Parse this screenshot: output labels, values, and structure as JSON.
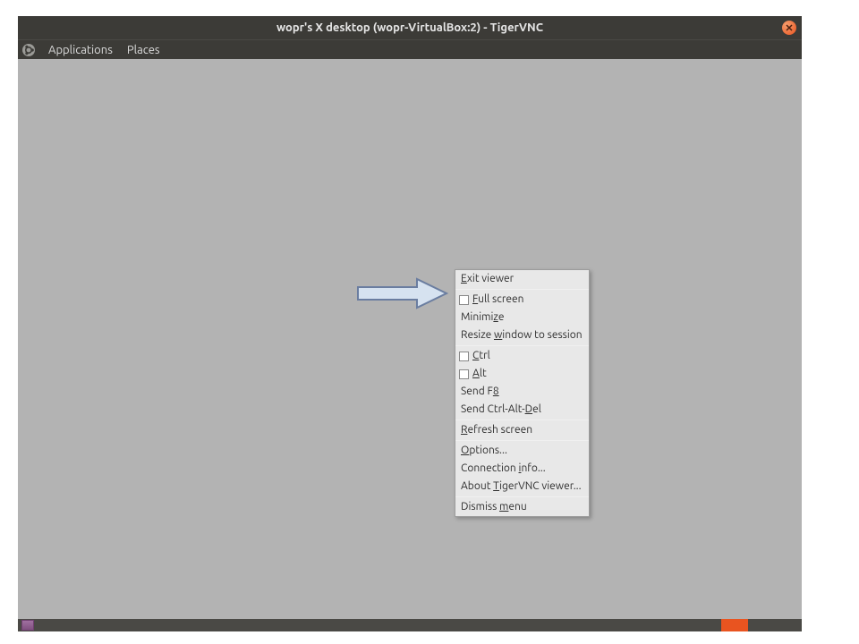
{
  "titlebar": {
    "title": "wopr's X desktop (wopr-VirtualBox:2) - TigerVNC"
  },
  "menubar": {
    "applications": "Applications",
    "places": "Places"
  },
  "context_menu": {
    "exit_viewer": {
      "pre": "",
      "u": "E",
      "post": "xit viewer"
    },
    "full_screen": {
      "pre": "",
      "u": "F",
      "post": "ull screen"
    },
    "minimize": {
      "pre": "Minimi",
      "u": "z",
      "post": "e"
    },
    "resize": {
      "pre": "Resize ",
      "u": "w",
      "post": "indow to session"
    },
    "ctrl": {
      "pre": "",
      "u": "C",
      "post": "trl"
    },
    "alt": {
      "pre": "",
      "u": "A",
      "post": "lt"
    },
    "send_f8": {
      "pre": "Send F",
      "u": "8",
      "post": ""
    },
    "send_cad": {
      "pre": "Send Ctrl-Alt-",
      "u": "D",
      "post": "el"
    },
    "refresh": {
      "pre": "",
      "u": "R",
      "post": "efresh screen"
    },
    "options": {
      "pre": "",
      "u": "O",
      "post": "ptions..."
    },
    "conn_info": {
      "pre": "Connection ",
      "u": "i",
      "post": "nfo..."
    },
    "about": {
      "pre": "About ",
      "u": "T",
      "post": "igerVNC viewer..."
    },
    "dismiss": {
      "pre": "Dismiss ",
      "u": "m",
      "post": "enu"
    }
  }
}
